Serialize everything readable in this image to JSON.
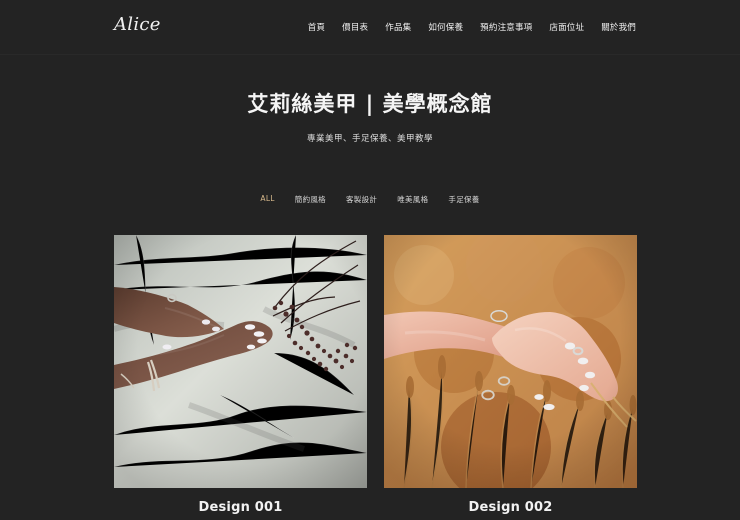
{
  "header": {
    "logo": "Alice",
    "nav": [
      {
        "label": "首頁"
      },
      {
        "label": "價目表"
      },
      {
        "label": "作品集"
      },
      {
        "label": "如何保養"
      },
      {
        "label": "預約注意事項"
      },
      {
        "label": "店面位址"
      },
      {
        "label": "關於我們"
      }
    ]
  },
  "hero": {
    "title": "艾莉絲美甲 | 美學概念館",
    "subtitle": "專業美甲、手足保養、美甲教學"
  },
  "filters": [
    {
      "label": "ALL",
      "active": true
    },
    {
      "label": "簡約風格"
    },
    {
      "label": "客製設計"
    },
    {
      "label": "唯美風格"
    },
    {
      "label": "手足保養"
    }
  ],
  "gallery": [
    {
      "title": "Design 001"
    },
    {
      "title": "Design 002"
    }
  ],
  "colors": {
    "background": "#232323",
    "active_filter": "#d7b98c"
  }
}
